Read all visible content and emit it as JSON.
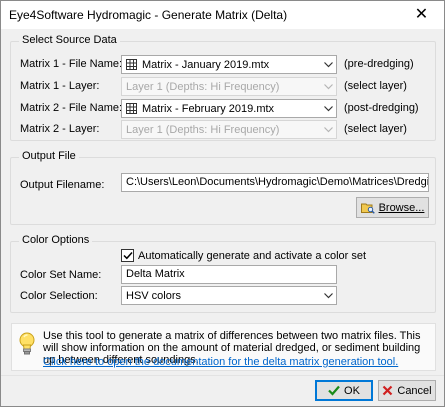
{
  "window": {
    "title": "Eye4Software Hydromagic - Generate Matrix (Delta)",
    "close_glyph": "✕"
  },
  "source": {
    "group_label": "Select Source Data",
    "matrix1_file_label": "Matrix 1 - File Name:",
    "matrix1_file_value": "Matrix - January 2019.mtx",
    "matrix1_file_hint": "(pre-dredging)",
    "matrix1_layer_label": "Matrix 1 - Layer:",
    "matrix1_layer_value": "Layer 1 (Depths: Hi Frequency)",
    "matrix1_layer_hint": "(select layer)",
    "matrix2_file_label": "Matrix 2 - File Name:",
    "matrix2_file_value": "Matrix - February 2019.mtx",
    "matrix2_file_hint": "(post-dredging)",
    "matrix2_layer_label": "Matrix 2 - Layer:",
    "matrix2_layer_value": "Layer 1 (Depths: Hi Frequency)",
    "matrix2_layer_hint": "(select layer)"
  },
  "output": {
    "group_label": "Output File",
    "filename_label": "Output Filename:",
    "filename_value": "C:\\Users\\Leon\\Documents\\Hydromagic\\Demo\\Matrices\\Dredging - Progress.mtx",
    "browse_label": "Browse..."
  },
  "color": {
    "group_label": "Color Options",
    "auto_checkbox_label": "Automatically generate and activate a color set",
    "auto_checked": true,
    "set_name_label": "Color Set Name:",
    "set_name_value": "Delta Matrix",
    "selection_label": "Color Selection:",
    "selection_value": "HSV colors"
  },
  "info": {
    "text": "Use this tool to generate a matrix of differences between two matrix files. This will show information on the amount of material dredged, or sediment building up between different soundings.",
    "link": "Click here to open the documentation for the delta matrix generation tool."
  },
  "buttons": {
    "ok_label": "OK",
    "cancel_label": "Cancel"
  },
  "colors": {
    "accent": "#0078d7",
    "link": "#0066cc",
    "ok_check": "#1a8a1a",
    "cancel_x": "#d02020"
  }
}
